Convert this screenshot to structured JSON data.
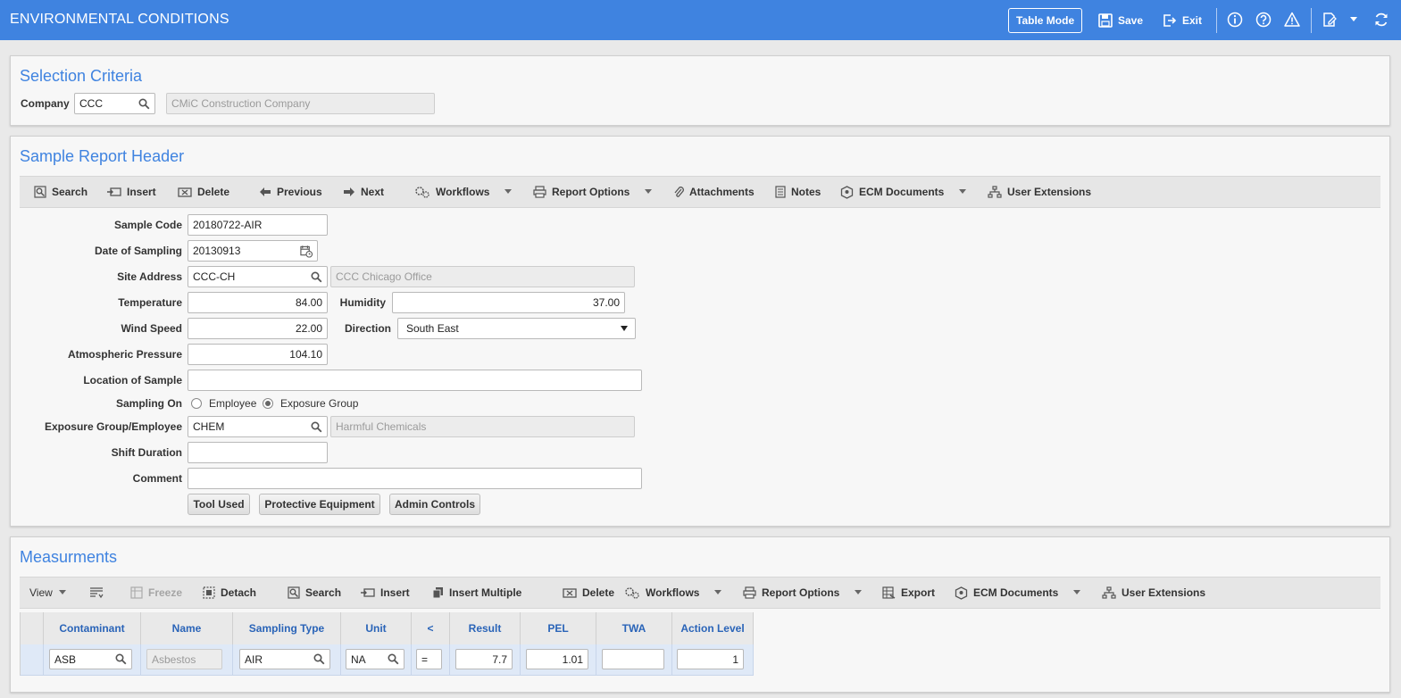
{
  "app": {
    "title": "ENVIRONMENTAL CONDITIONS",
    "table_mode_label": "Table Mode",
    "save_label": "Save",
    "exit_label": "Exit"
  },
  "selection": {
    "title": "Selection Criteria",
    "company_label": "Company",
    "company_value": "CCC",
    "company_name": "CMiC Construction Company"
  },
  "header": {
    "title": "Sample Report Header",
    "toolbar": {
      "search": "Search",
      "insert": "Insert",
      "delete": "Delete",
      "previous": "Previous",
      "next": "Next",
      "workflows": "Workflows",
      "report_options": "Report Options",
      "attachments": "Attachments",
      "notes": "Notes",
      "ecm_documents": "ECM Documents",
      "user_extensions": "User Extensions"
    },
    "fields": {
      "sample_code_label": "Sample Code",
      "sample_code": "20180722-AIR",
      "date_label": "Date of Sampling",
      "date": "20130913",
      "site_address_label": "Site Address",
      "site_address": "CCC-CH",
      "site_name": "CCC Chicago Office",
      "temperature_label": "Temperature",
      "temperature": "84.00",
      "humidity_label": "Humidity",
      "humidity": "37.00",
      "wind_speed_label": "Wind Speed",
      "wind_speed": "22.00",
      "direction_label": "Direction",
      "direction": "South East",
      "pressure_label": "Atmospheric Pressure",
      "pressure": "104.10",
      "location_label": "Location of Sample",
      "location": "",
      "sampling_on_label": "Sampling On",
      "sampling_on_options": [
        "Employee",
        "Exposure Group"
      ],
      "sampling_on_selected": "Exposure Group",
      "exposure_label": "Exposure Group/Employee",
      "exposure": "CHEM",
      "exposure_name": "Harmful Chemicals",
      "shift_duration_label": "Shift Duration",
      "shift_duration": "",
      "comment_label": "Comment",
      "comment": ""
    },
    "buttons": {
      "tool_used": "Tool Used",
      "protective_equipment": "Protective Equipment",
      "admin_controls": "Admin Controls"
    }
  },
  "measurements": {
    "title": "Measurments",
    "toolbar": {
      "view": "View",
      "freeze": "Freeze",
      "detach": "Detach",
      "search": "Search",
      "insert": "Insert",
      "insert_multiple": "Insert Multiple",
      "delete": "Delete",
      "workflows": "Workflows",
      "report_options": "Report Options",
      "export": "Export",
      "ecm_documents": "ECM Documents",
      "user_extensions": "User Extensions"
    },
    "columns": [
      "Contaminant",
      "Name",
      "Sampling Type",
      "Unit",
      "<",
      "Result",
      "PEL",
      "TWA",
      "Action Level"
    ],
    "rows": [
      {
        "contaminant": "ASB",
        "name": "Asbestos",
        "sampling_type": "AIR",
        "unit": "NA",
        "op": "=",
        "result": "7.7",
        "pel": "1.01",
        "twa": "",
        "action_level": "1"
      }
    ]
  },
  "colors": {
    "brand": "#3f83e0",
    "header_text": "#2a64b8",
    "row_highlight": "#dfe9f7"
  }
}
